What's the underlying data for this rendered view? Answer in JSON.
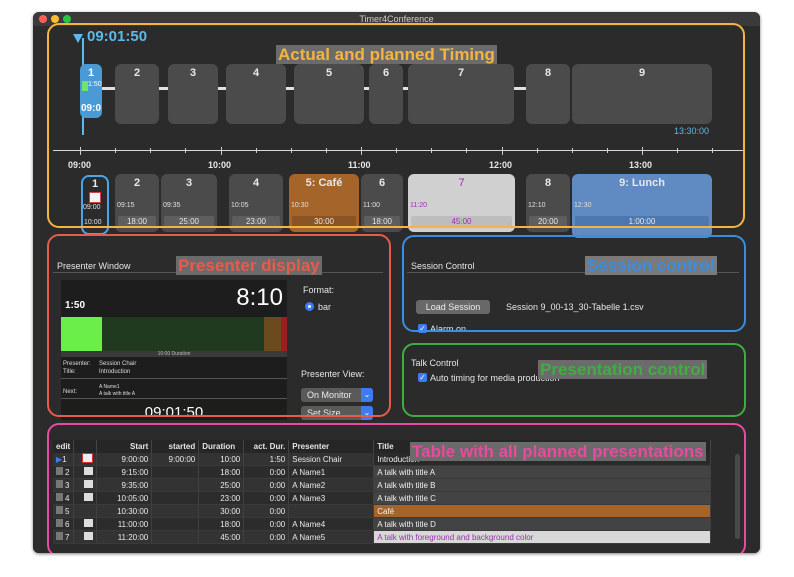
{
  "window": {
    "title": "Timer4Conference",
    "traffic_lights": [
      "#ff5f57",
      "#febc2e",
      "#28c840"
    ]
  },
  "callouts": {
    "timing": {
      "label": "Actual and planned Timing",
      "color": "#f3b53f"
    },
    "presenter": {
      "label": "Presenter display",
      "color": "#e85b4a"
    },
    "session": {
      "label": "Session control",
      "color": "#3a8de0"
    },
    "presentation": {
      "label": "Presentation control",
      "color": "#3fae3f"
    },
    "table": {
      "label": "Table with all planned presentations",
      "color": "#e64b9f"
    }
  },
  "actual_timeline": {
    "now_time": "09:01:50",
    "current_label": "09:0",
    "current_small": "1:50",
    "end_time": "13:30:00",
    "blocks": [
      "1",
      "2",
      "3",
      "4",
      "5",
      "6",
      "7",
      "8",
      "9"
    ]
  },
  "axis": {
    "labels": [
      "09:00",
      "10:00",
      "11:00",
      "12:00",
      "13:00"
    ]
  },
  "planned_timeline": {
    "items": [
      {
        "title": "1",
        "start": "09:00",
        "duration": "10:00"
      },
      {
        "title": "2",
        "start": "09:15",
        "duration": "18:00"
      },
      {
        "title": "3",
        "start": "09:35",
        "duration": "25:00"
      },
      {
        "title": "4",
        "start": "10:05",
        "duration": "23:00"
      },
      {
        "title": "5: Café",
        "start": "10:30",
        "duration": "30:00",
        "color": "#a5652a"
      },
      {
        "title": "6",
        "start": "11:00",
        "duration": "18:00"
      },
      {
        "title": "7",
        "start": "11:20",
        "duration": "45:00",
        "color": "#cfcfcf",
        "text_color": "#9b2fae"
      },
      {
        "title": "8",
        "start": "12:10",
        "duration": "20:00"
      },
      {
        "title": "9: Lunch",
        "start": "12:30",
        "duration": "1:00:00",
        "color": "#5f8ac2"
      }
    ]
  },
  "presenter_window": {
    "header": "Presenter Window",
    "elapsed": "1:50",
    "remaining": "8:10",
    "bar_label": "10:00  Duration",
    "progress": 0.18,
    "presenter_label": "Presenter:",
    "presenter_value": "Session Chair",
    "title_label": "Title:",
    "title_value": "Introduction",
    "next_label": "Next:",
    "next_value_1": "A Name1",
    "next_value_2": "A talk with title A",
    "clock": "09:01:50",
    "format_label": "Format:",
    "format_option": "bar",
    "view_label": "Presenter View:",
    "view_select": "On Monitor",
    "size_select": "Set Size"
  },
  "session_control": {
    "header": "Session Control",
    "load_button": "Load Session",
    "session_file": "Session 9_00-13_30-Tabelle 1.csv",
    "alarm_label": "Alarm on"
  },
  "talk_control": {
    "header": "Talk Control",
    "auto_label": "Auto timing for media production"
  },
  "table": {
    "columns": [
      "edit",
      "",
      "Start",
      "started",
      "Duration",
      "act. Dur.",
      "Presenter",
      "Title"
    ],
    "rows": [
      {
        "n": "1",
        "start": "9:00:00",
        "started": "9:00:00",
        "duration": "10:00",
        "act": "1:50",
        "presenter": "Session Chair",
        "title": "Introduction"
      },
      {
        "n": "2",
        "start": "9:15:00",
        "started": "",
        "duration": "18:00",
        "act": "0:00",
        "presenter": "A Name1",
        "title": "A talk with title A"
      },
      {
        "n": "3",
        "start": "9:35:00",
        "started": "",
        "duration": "25:00",
        "act": "0:00",
        "presenter": "A Name2",
        "title": "A talk with title B"
      },
      {
        "n": "4",
        "start": "10:05:00",
        "started": "",
        "duration": "23:00",
        "act": "0:00",
        "presenter": "A Name3",
        "title": "A talk with title C"
      },
      {
        "n": "5",
        "start": "10:30:00",
        "started": "",
        "duration": "30:00",
        "act": "0:00",
        "presenter": "",
        "title": "Café"
      },
      {
        "n": "6",
        "start": "11:00:00",
        "started": "",
        "duration": "18:00",
        "act": "0:00",
        "presenter": "A Name4",
        "title": "A talk with title D"
      },
      {
        "n": "7",
        "start": "11:20:00",
        "started": "",
        "duration": "45:00",
        "act": "0:00",
        "presenter": "A Name5",
        "title": "A talk with foreground and background color"
      }
    ]
  }
}
